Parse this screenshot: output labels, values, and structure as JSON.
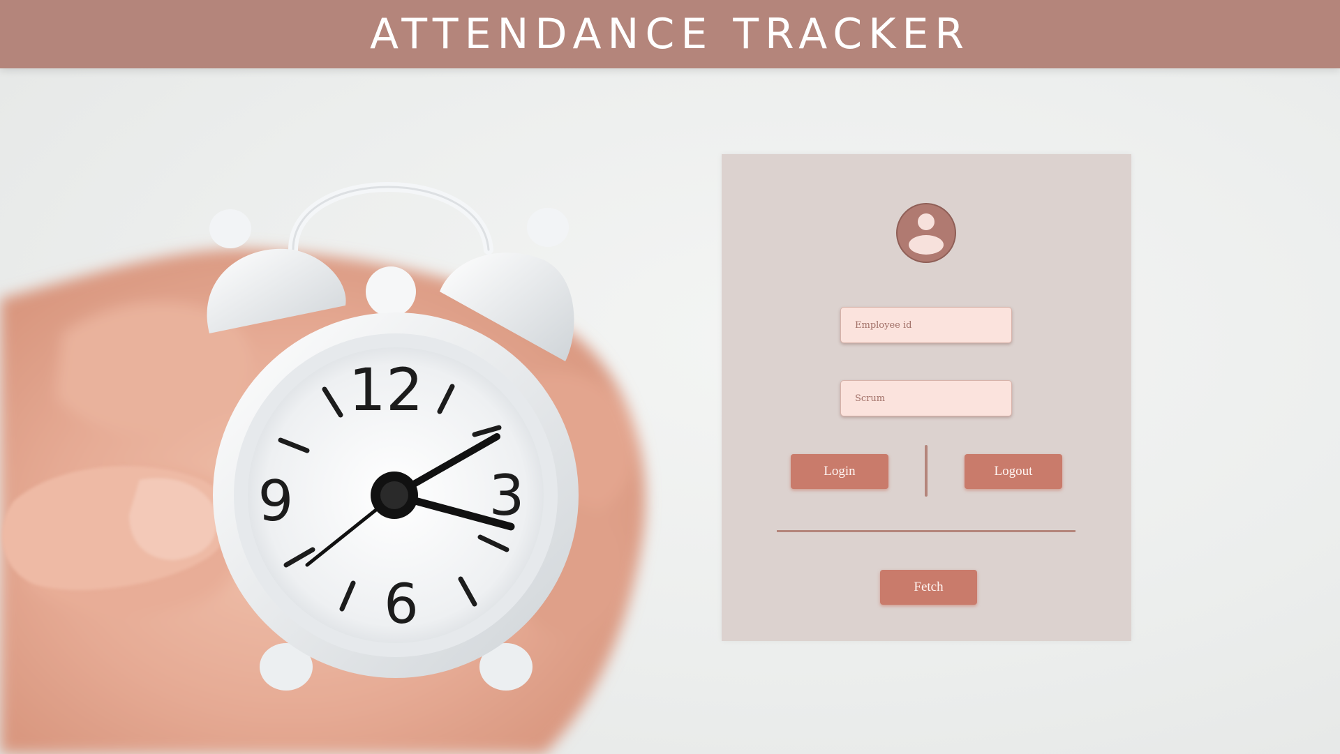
{
  "header": {
    "title": "ATTENDANCE TRACKER"
  },
  "hero": {
    "clock_numerals": [
      "12",
      "3",
      "6",
      "9"
    ]
  },
  "login_card": {
    "avatar_icon": "user-circle-icon",
    "employee_id": {
      "placeholder": "Employee id",
      "value": ""
    },
    "scrum": {
      "placeholder": "Scrum",
      "value": ""
    },
    "login_label": "Login",
    "logout_label": "Logout",
    "fetch_label": "Fetch"
  },
  "colors": {
    "header_bg": "#b4857b",
    "card_bg": "#dcd2cf",
    "button_bg": "#c97b6b",
    "input_bg": "#fbe3dd"
  }
}
